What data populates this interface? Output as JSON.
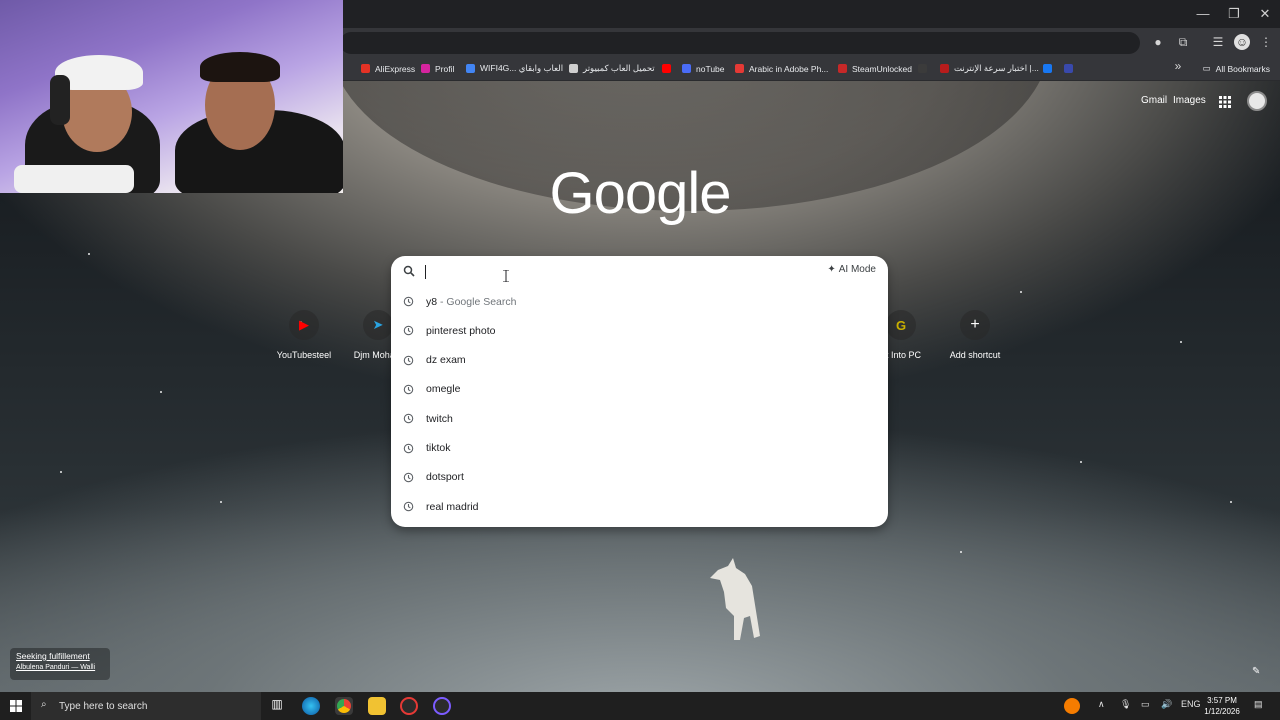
{
  "browser": {
    "bookmarks": [
      {
        "label": "AliExpress",
        "color": "#e43225"
      },
      {
        "label": "Profil",
        "color": "#d6249f"
      },
      {
        "label": "WIFI4G... العاب وابقاي",
        "color": "#4285f4"
      },
      {
        "label": "تحميل العاب كمبيوتر",
        "color": "#cfcfcf"
      },
      {
        "label": "",
        "color": "#ff0000"
      },
      {
        "label": "noTube",
        "color": "#4a6cf7"
      },
      {
        "label": "Arabic in Adobe Ph...",
        "color": "#e53935"
      },
      {
        "label": "SteamUnlocked",
        "color": "#c62828"
      },
      {
        "label": "",
        "color": "#3b3b3b"
      },
      {
        "label": "اختبار سرعة الإنترنت |...",
        "color": "#b71c1c"
      },
      {
        "label": "",
        "color": "#1877f2"
      },
      {
        "label": "",
        "color": "#3949ab"
      }
    ],
    "all_bookmarks_label": "All Bookmarks"
  },
  "header": {
    "gmail": "Gmail",
    "images": "Images",
    "logo_text": "Google"
  },
  "shortcuts": [
    {
      "label": "YouTubesteel",
      "icon": "youtube-icon",
      "glyph": "▶",
      "color": "#ff0000"
    },
    {
      "label": "Djm Moha...",
      "icon": "telegram-icon",
      "glyph": "➤",
      "color": "#2aa3e0"
    },
    {
      "label": "et Into PC",
      "icon": "getintopc-icon",
      "glyph": "G",
      "color": "#c9b000"
    },
    {
      "label": "Add shortcut",
      "icon": "plus-icon",
      "glyph": "+",
      "color": "#ffffff"
    }
  ],
  "search": {
    "ai_mode_label": "AI Mode",
    "suggestions": [
      {
        "text": "y8",
        "sub": " - Google Search"
      },
      {
        "text": "pinterest photo",
        "sub": ""
      },
      {
        "text": "dz exam",
        "sub": ""
      },
      {
        "text": "omegle",
        "sub": ""
      },
      {
        "text": "twitch",
        "sub": ""
      },
      {
        "text": "tiktok",
        "sub": ""
      },
      {
        "text": "dotsport",
        "sub": ""
      },
      {
        "text": "real madrid",
        "sub": ""
      }
    ]
  },
  "wallpaper_credit": {
    "title": "Seeking fulfillement",
    "author": "Albulena Panduri — Walli"
  },
  "taskbar": {
    "search_placeholder": "Type here to search",
    "language": "ENG",
    "time": "3:57 PM",
    "date": "1/12/2026"
  }
}
